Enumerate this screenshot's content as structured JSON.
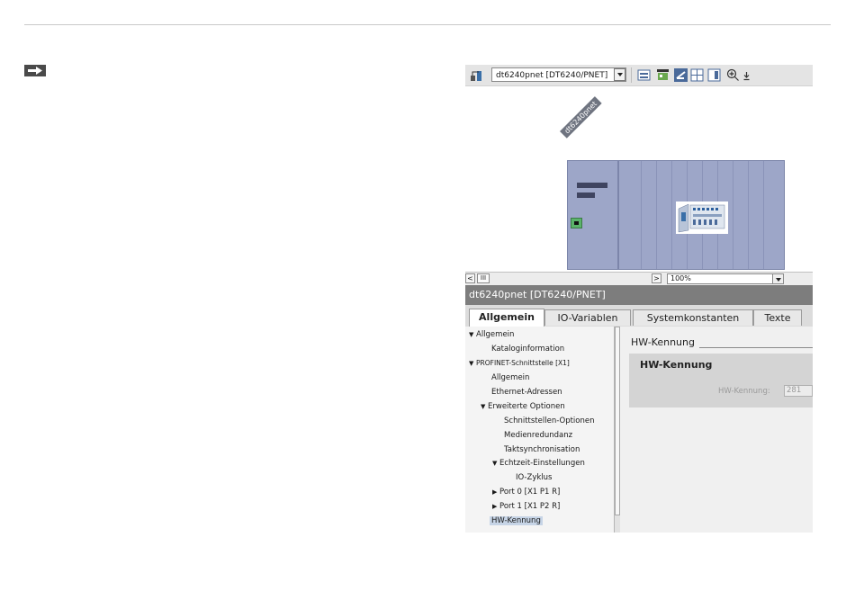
{
  "toolbar": {
    "device_select_value": "dt6240pnet [DT6240/PNET]",
    "icons": [
      "network-icon",
      "dropdown-icon",
      "view-icon",
      "module-icon",
      "table-icon",
      "grid-icon",
      "list-icon",
      "zoom-in-icon"
    ]
  },
  "canvas": {
    "device_label": "dt6240pnet",
    "zoom_value": "100%",
    "scroll_thumb_label": "III"
  },
  "inspector": {
    "title": "dt6240pnet [DT6240/PNET]",
    "tabs": [
      {
        "label": "Allgemein",
        "active": true
      },
      {
        "label": "IO-Variablen",
        "active": false
      },
      {
        "label": "Systemkonstanten",
        "active": false
      },
      {
        "label": "Texte",
        "active": false
      }
    ],
    "tree": [
      {
        "label": "Allgemein",
        "arrow": "▼"
      },
      {
        "label": "Kataloginformation",
        "arrow": ""
      },
      {
        "label": "PROFINET-Schnittstelle [X1]",
        "arrow": "▼"
      },
      {
        "label": "Allgemein",
        "arrow": ""
      },
      {
        "label": "Ethernet-Adressen",
        "arrow": ""
      },
      {
        "label": "Erweiterte Optionen",
        "arrow": "▼"
      },
      {
        "label": "Schnittstellen-Optionen",
        "arrow": ""
      },
      {
        "label": "Medienredundanz",
        "arrow": ""
      },
      {
        "label": "Taktsynchronisation",
        "arrow": ""
      },
      {
        "label": "Echtzeit-Einstellungen",
        "arrow": "▼"
      },
      {
        "label": "IO-Zyklus",
        "arrow": ""
      },
      {
        "label": "Port 0 [X1 P1 R]",
        "arrow": "▶"
      },
      {
        "label": "Port 1 [X1 P2 R]",
        "arrow": "▶"
      },
      {
        "label": "HW-Kennung",
        "arrow": ""
      }
    ],
    "section_heading": "HW-Kennung",
    "group_title": "HW-Kennung",
    "hw_field_label": "HW-Kennung:",
    "hw_field_value": "281"
  },
  "colors": {
    "rack": "#9da6c8",
    "inspector_title_bg": "#7d7d7d",
    "selection": "#c6d4e6"
  }
}
